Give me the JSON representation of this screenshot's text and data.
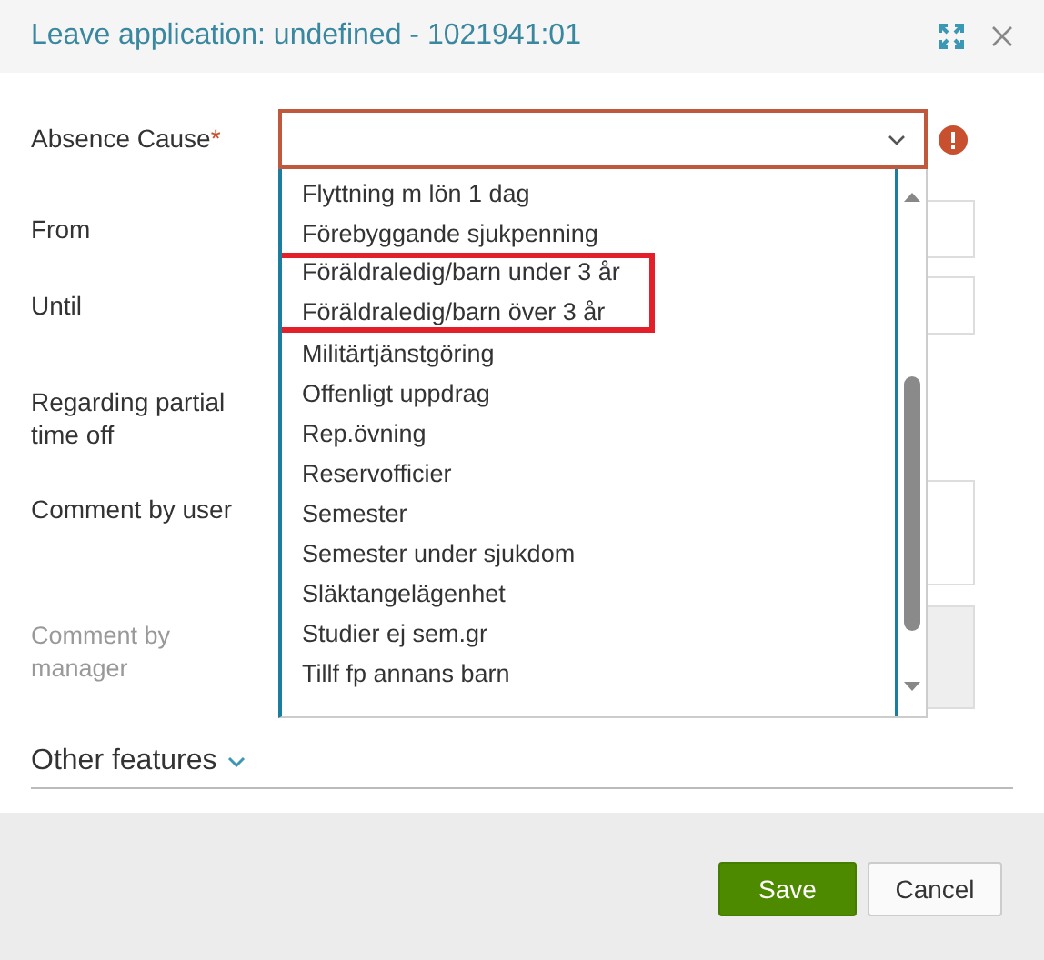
{
  "window": {
    "title": "Leave application: undefined - 1021941:01"
  },
  "form": {
    "absence_cause": {
      "label": "Absence Cause",
      "required_mark": "*",
      "error": true
    },
    "from": {
      "label": "From"
    },
    "until": {
      "label": "Until"
    },
    "partial": {
      "label": "Regarding partial time off"
    },
    "comment_user": {
      "label": "Comment by user"
    },
    "comment_manager": {
      "label": "Comment by manager",
      "disabled": true
    }
  },
  "dropdown": {
    "items": [
      {
        "label": "Flyttning m lön 1 dag",
        "highlighted": false
      },
      {
        "label": "Förebyggande sjukpenning",
        "highlighted": false
      },
      {
        "label": "Föräldraledig/barn under 3 år",
        "highlighted": true
      },
      {
        "label": "Föräldraledig/barn över 3 år",
        "highlighted": true
      },
      {
        "label": "Militärtjänstgöring",
        "highlighted": false
      },
      {
        "label": "Offenligt uppdrag",
        "highlighted": false
      },
      {
        "label": "Rep.övning",
        "highlighted": false
      },
      {
        "label": "Reservofficier",
        "highlighted": false
      },
      {
        "label": "Semester",
        "highlighted": false
      },
      {
        "label": "Semester under sjukdom",
        "highlighted": false
      },
      {
        "label": "Släktangelägenhet",
        "highlighted": false
      },
      {
        "label": "Studier ej sem.gr",
        "highlighted": false
      },
      {
        "label": "Tillf fp annans barn",
        "highlighted": false
      }
    ]
  },
  "other_features": {
    "label": "Other features",
    "expanded": false
  },
  "buttons": [
    {
      "label": "Save",
      "kind": "primary"
    },
    {
      "label": "Cancel",
      "kind": "secondary"
    }
  ]
}
